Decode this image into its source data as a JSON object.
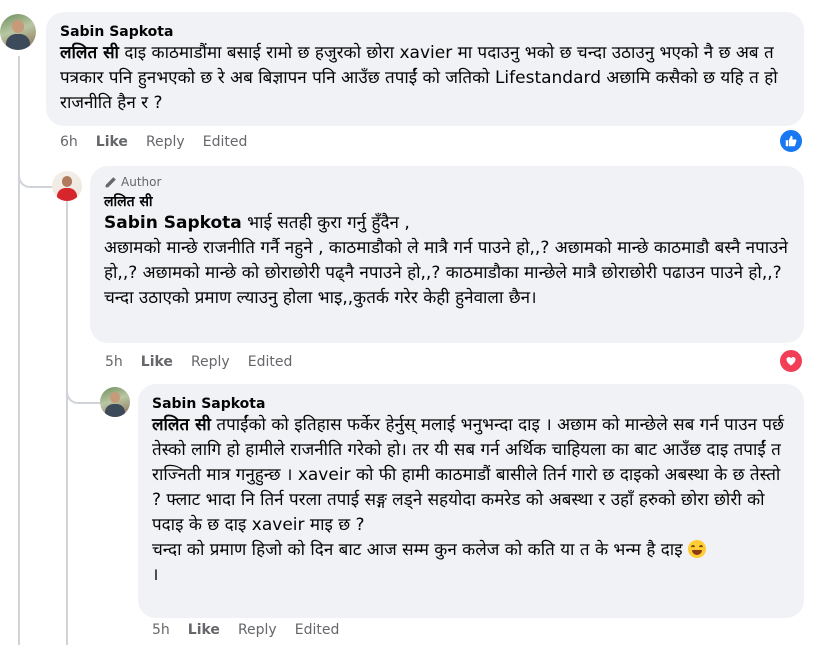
{
  "comments": [
    {
      "author": "Sabin Sapkota",
      "tag": "ललित सी",
      "text": " दाइ काठमाडौंमा बसाई रामो छ हजुरको छोरा xavier मा पदाउनु भको छ चन्दा उठाउनु भएको नै छ अब त पत्रकार पनि हुनभएको छ रे अब बिज्ञापन पनि आउँछ तपाईं को जतिको Lifestandard अछामि कसैको छ यहि त हो राजनीति हैन र ?",
      "time": "6h",
      "like": "Like",
      "reply": "Reply",
      "edited": "Edited",
      "reaction": "like"
    },
    {
      "badge": "Author",
      "author": "ललित सी",
      "tag": "Sabin Sapkota",
      "text": " भाई सतही कुरा गर्नु हुँदैन ,\nअछामको मान्छे राजनीति गर्नै नहुने , काठमाडौको ले मात्रै गर्न पाउने हो,,? अछामको मान्छे काठमाडौ बस्नै नपाउने हो,,? अछामको मान्छे को छोराछोरी पढ्नै नपाउने हो,,? काठमाडौका मान्छेले मात्रै छोराछोरी पढाउन पाउने हो,,? चन्दा उठाएको प्रमाण ल्याउनु होला भाइ,,कुतर्क गरेर केही हुनेवाला छैन।",
      "time": "5h",
      "like": "Like",
      "reply": "Reply",
      "edited": "Edited",
      "reaction": "love"
    },
    {
      "author": "Sabin Sapkota",
      "tag": "ललित सी",
      "text": " तपाईंको को इतिहास फर्केर हेर्नुस् मलाई भनुभन्दा दाइ । अछाम को मान्छेले सब गर्न पाउन पर्छ तेस्को लागि हो हामीले राजनीति गरेको हो। तर यी सब गर्न अर्थिक चाहियला का बाट आउँछ दाइ तपाईं त राज्निती मात्र गनुहुन्छ । xaveir को फी हामी काठमाडौं बासीले तिर्न गारो छ दाइको अबस्था के छ तेस्तो ? फ्लाट भादा नि तिर्न परला तपाई सङ्ग लड्ने सहयोदा कमरेड को अबस्था र उहाँ हरुको छोरा छोरी को पदाइ के छ दाइ xaveir माइ छ ?\nचन्दा को प्रमाण हिजो को दिन बाट आज सम्म कुन कलेज को कति या त के भन्म है दाइ",
      "text_end": "।",
      "time": "5h",
      "like": "Like",
      "reply": "Reply",
      "edited": "Edited"
    }
  ],
  "colors": {
    "like_blue": "#1877f2",
    "love_red": "#f33e58",
    "bubble": "#f0f2f5",
    "meta": "#65676b"
  },
  "icons": [
    "thumbs-up-icon",
    "heart-icon",
    "pencil-icon",
    "grinning-face-emoji"
  ]
}
